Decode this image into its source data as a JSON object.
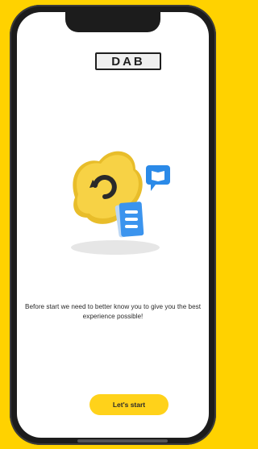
{
  "brand": {
    "logo_text": "DAB"
  },
  "onboarding": {
    "message": "Before start we need to better know you to give you the best experience possible!",
    "cta_label": "Let's start"
  },
  "icons": [
    "dab-app-cloud-icon",
    "chat-book-icon",
    "document-icon"
  ],
  "colors": {
    "accent": "#ffd21a",
    "background": "#ffd200",
    "icon_blue": "#2b8ae8"
  }
}
